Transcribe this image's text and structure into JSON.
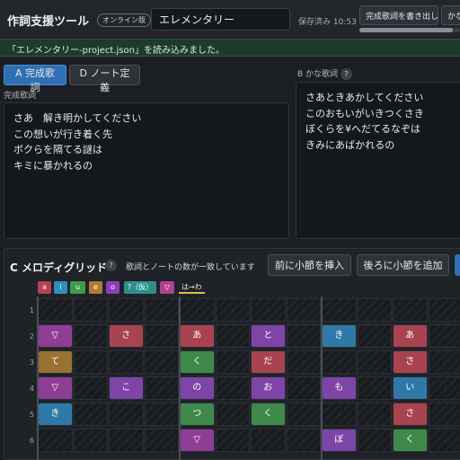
{
  "header": {
    "app_title": "作詞支援ツール",
    "badge": "オンライン版",
    "song_title": "エレメンタリー",
    "saved_status": "保存済み 10:53",
    "export_button": "完成歌詞を書き出し",
    "kana_button": "かな",
    "progress": 0.93
  },
  "notice": "「エレメンタリー-project.json」を読み込みました。",
  "tabs": [
    {
      "label": "A 完成歌詞",
      "active": true
    },
    {
      "label": "D ノート定義",
      "active": false
    }
  ],
  "lyrics": {
    "label": "完成歌詞",
    "lines": [
      "さあ　解き明かしてください",
      "この想いが行き着く先",
      "ボクらを隔てる謎は",
      "キミに暴かれるの"
    ]
  },
  "kana": {
    "label": "B かな歌詞",
    "help": "?",
    "lines": [
      "さあときあかしてください",
      "このおもいがいきつくさき",
      "ぼくらを¥へだてるなぞは",
      "きみにあばかれるの"
    ]
  },
  "grid": {
    "title": "C メロディグリッド",
    "help": "?",
    "status": "歌詞とノートの数が一致しています",
    "insert_before": "前に小節を挿入",
    "insert_after": "後ろに小節を追加",
    "legend_chips": [
      {
        "label": "a",
        "color": "#b8404f"
      },
      {
        "label": "i",
        "color": "#2f8fb8"
      },
      {
        "label": "u",
        "color": "#3f9a4a"
      },
      {
        "label": "e",
        "color": "#b07a30"
      },
      {
        "label": "o",
        "color": "#8a3fb8"
      },
      {
        "label": "?（仮）",
        "color": "#2e8e8e"
      },
      {
        "label": "▽",
        "color": "#b0408f"
      }
    ],
    "conversion_label": "は→わ",
    "empty_mark": "·",
    "rows": [
      "1",
      "2",
      "3",
      "4",
      "5",
      "6"
    ],
    "notes": [
      {
        "row": 1,
        "col": 0,
        "text": "▽",
        "color": "#8e3f95"
      },
      {
        "row": 1,
        "col": 2,
        "text": "さ",
        "color": "#a8434f"
      },
      {
        "row": 1,
        "col": 4,
        "text": "あ",
        "color": "#a8434f"
      },
      {
        "row": 1,
        "col": 6,
        "text": "と",
        "color": "#7f44a8"
      },
      {
        "row": 1,
        "col": 8,
        "text": "き",
        "color": "#2f79a8"
      },
      {
        "row": 1,
        "col": 10,
        "text": "あ",
        "color": "#a8434f"
      },
      {
        "row": 2,
        "col": 0,
        "text": "て",
        "color": "#9a7033"
      },
      {
        "row": 2,
        "col": 4,
        "text": "く",
        "color": "#3f8a4a"
      },
      {
        "row": 2,
        "col": 6,
        "text": "だ",
        "color": "#a8434f"
      },
      {
        "row": 2,
        "col": 10,
        "text": "さ",
        "color": "#a8434f"
      },
      {
        "row": 3,
        "col": 0,
        "text": "▽",
        "color": "#8e3f95"
      },
      {
        "row": 3,
        "col": 2,
        "text": "こ",
        "color": "#7f44a8"
      },
      {
        "row": 3,
        "col": 4,
        "text": "の",
        "color": "#7f44a8"
      },
      {
        "row": 3,
        "col": 6,
        "text": "お",
        "color": "#7f44a8"
      },
      {
        "row": 3,
        "col": 8,
        "text": "も",
        "color": "#7f44a8"
      },
      {
        "row": 3,
        "col": 10,
        "text": "い",
        "color": "#2f79a8"
      },
      {
        "row": 4,
        "col": 0,
        "text": "き",
        "color": "#2f79a8"
      },
      {
        "row": 4,
        "col": 4,
        "text": "つ",
        "color": "#3f8a4a"
      },
      {
        "row": 4,
        "col": 6,
        "text": "く",
        "color": "#3f8a4a"
      },
      {
        "row": 4,
        "col": 10,
        "text": "さ",
        "color": "#a8434f"
      },
      {
        "row": 5,
        "col": 4,
        "text": "▽",
        "color": "#8e3f95"
      },
      {
        "row": 5,
        "col": 8,
        "text": "ぼ",
        "color": "#7f44a8"
      },
      {
        "row": 5,
        "col": 10,
        "text": "く",
        "color": "#3f8a4a"
      }
    ]
  }
}
